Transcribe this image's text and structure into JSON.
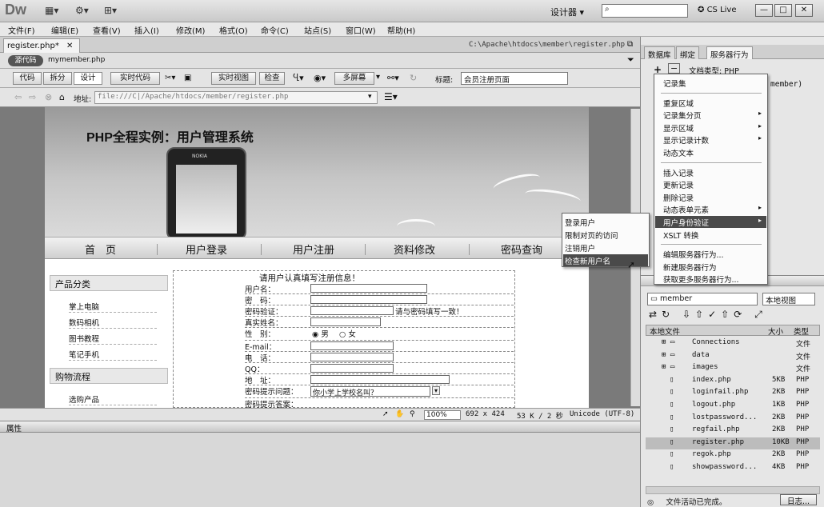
{
  "app": {
    "logo": "Dw",
    "workspace": "设计器",
    "cs_live": "CS Live",
    "win_min": "—",
    "win_max": "□",
    "win_close": "✕"
  },
  "menubar": [
    "文件(F)",
    "编辑(E)",
    "查看(V)",
    "插入(I)",
    "修改(M)",
    "格式(O)",
    "命令(C)",
    "站点(S)",
    "窗口(W)",
    "帮助(H)"
  ],
  "doc": {
    "tab": "register.php*",
    "path": "C:\\Apache\\htdocs\\member\\register.php",
    "source_btn": "源代码",
    "related_file": "mymember.php",
    "views": [
      "代码",
      "拆分",
      "设计"
    ],
    "live_code": "实时代码",
    "live_view": "实时视图",
    "inspect": "检查",
    "multiscreen": "多屏幕",
    "title_label": "标题:",
    "title_value": "会员注册页面",
    "address_label": "地址:",
    "address": "file:///C|/Apache/htdocs/member/register.php"
  },
  "page": {
    "banner_title": "PHP全程实例：用户管理系统",
    "phone_brand": "NOKIA",
    "nav": [
      "首　页",
      "用户登录",
      "用户注册",
      "资料修改",
      "密码查询"
    ],
    "sidebar": {
      "products_head": "产品分类",
      "products": [
        "掌上电脑",
        "数码相机",
        "图书教程",
        "笔记手机"
      ],
      "flow_head": "购物流程",
      "flow": [
        "选购产品"
      ]
    },
    "form_title": "请用户认真填写注册信息！",
    "form_rows": [
      "用户名：",
      "密　码：",
      "密码验证：",
      "真实姓名：",
      "性　别：",
      "E-mail：",
      "电　话：",
      "QQ：",
      "地　址：",
      "密码提示问题：",
      "密码提示答案："
    ],
    "pwd_hint": "请与密码填写一致！",
    "gender_male": "男",
    "gender_female": "女",
    "question_value": "你小学上学校名叫？"
  },
  "statusbar": {
    "zoom": "100%",
    "size": "692 x 424",
    "filesize": "53 K / 2 秒",
    "encoding": "Unicode (UTF-8)"
  },
  "props_label": "属性",
  "panel": {
    "tabs": [
      "数据库",
      "绑定",
      "服务器行为"
    ],
    "add": "+",
    "remove": "−",
    "doctype": "文档类型: PHP",
    "behind_text": "member)"
  },
  "context_menu": {
    "items": [
      "记录集",
      "",
      "重复区域",
      "记录集分页",
      "显示区域",
      "显示记录计数",
      "动态文本",
      "",
      "插入记录",
      "更新记录",
      "删除记录",
      "动态表单元素",
      "用户身份验证",
      "XSLT 转换",
      "",
      "编辑服务器行为...",
      "新建服务器行为",
      "获取更多服务器行为..."
    ],
    "with_arrow": [
      3,
      4,
      5,
      11,
      12
    ],
    "highlight": 12
  },
  "submenu": {
    "items": [
      "登录用户",
      "限制对页的访问",
      "注销用户",
      "检查新用户名"
    ],
    "highlight": 3
  },
  "files": {
    "site": "member",
    "view": "本地视图",
    "headers": [
      "本地文件",
      "大小",
      "类型"
    ],
    "rows": [
      {
        "name": "Connections",
        "size": "",
        "type": "文件"
      },
      {
        "name": "data",
        "size": "",
        "type": "文件"
      },
      {
        "name": "images",
        "size": "",
        "type": "文件"
      },
      {
        "name": "index.php",
        "size": "5KB",
        "type": "PHP"
      },
      {
        "name": "loginfail.php",
        "size": "2KB",
        "type": "PHP"
      },
      {
        "name": "logout.php",
        "size": "1KB",
        "type": "PHP"
      },
      {
        "name": "lostpassword...",
        "size": "2KB",
        "type": "PHP"
      },
      {
        "name": "regfail.php",
        "size": "2KB",
        "type": "PHP"
      },
      {
        "name": "register.php",
        "size": "10KB",
        "type": "PHP"
      },
      {
        "name": "regok.php",
        "size": "2KB",
        "type": "PHP"
      },
      {
        "name": "showpassword...",
        "size": "4KB",
        "type": "PHP"
      }
    ],
    "selected": 8,
    "status": "文件活动已完成。",
    "log_btn": "日志..."
  }
}
